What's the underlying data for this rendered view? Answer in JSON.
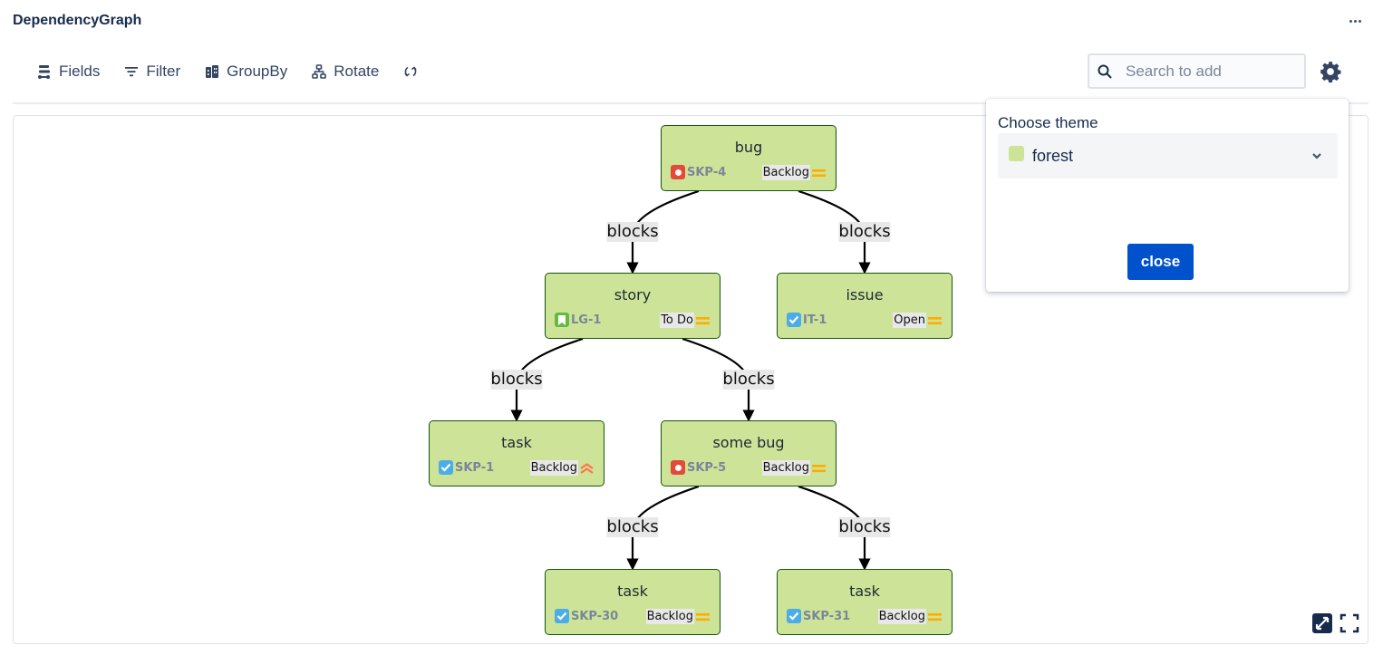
{
  "app": {
    "title": "DependencyGraph",
    "more_icon": "more-horizontal-icon"
  },
  "toolbar": {
    "fields": {
      "label": "Fields",
      "icon": "fields-icon"
    },
    "filter": {
      "label": "Filter",
      "icon": "filter-icon"
    },
    "groupby": {
      "label": "GroupBy",
      "icon": "groupby-icon"
    },
    "rotate": {
      "label": "Rotate",
      "icon": "hierarchy-icon"
    },
    "refresh": {
      "icon": "refresh-icon"
    }
  },
  "search": {
    "placeholder": "Search to add",
    "value": ""
  },
  "settings": {
    "icon": "gear-icon"
  },
  "theme_popover": {
    "label": "Choose theme",
    "selected": "forest",
    "swatch_color": "#cde498",
    "close_label": "close"
  },
  "colors": {
    "node_fill": "#cde498",
    "node_border": "#13540c",
    "bug": "#e5493a",
    "story": "#63ba3c",
    "task": "#4bade8",
    "priority_medium": "#ffab00",
    "priority_high": "#ff7452",
    "primary_button": "#0052cc"
  },
  "graph": {
    "nodes": [
      {
        "id": "n1",
        "title": "bug",
        "key": "SKP-4",
        "type": "bug",
        "status": "Backlog",
        "priority": "medium"
      },
      {
        "id": "n2",
        "title": "story",
        "key": "LG-1",
        "type": "story",
        "status": "To Do",
        "priority": "medium"
      },
      {
        "id": "n3",
        "title": "issue",
        "key": "IT-1",
        "type": "task",
        "status": "Open",
        "priority": "medium"
      },
      {
        "id": "n4",
        "title": "task",
        "key": "SKP-1",
        "type": "task",
        "status": "Backlog",
        "priority": "high"
      },
      {
        "id": "n5",
        "title": "some bug",
        "key": "SKP-5",
        "type": "bug",
        "status": "Backlog",
        "priority": "medium"
      },
      {
        "id": "n6",
        "title": "task",
        "key": "SKP-30",
        "type": "task",
        "status": "Backlog",
        "priority": "medium"
      },
      {
        "id": "n7",
        "title": "task",
        "key": "SKP-31",
        "type": "task",
        "status": "Backlog",
        "priority": "medium"
      }
    ],
    "edges": [
      {
        "from": "n1",
        "to": "n2",
        "label": "blocks"
      },
      {
        "from": "n1",
        "to": "n3",
        "label": "blocks"
      },
      {
        "from": "n2",
        "to": "n4",
        "label": "blocks"
      },
      {
        "from": "n2",
        "to": "n5",
        "label": "blocks"
      },
      {
        "from": "n5",
        "to": "n6",
        "label": "blocks"
      },
      {
        "from": "n5",
        "to": "n7",
        "label": "blocks"
      }
    ]
  },
  "canvas_controls": {
    "fit": "expand-icon",
    "fullscreen": "fullscreen-icon"
  }
}
